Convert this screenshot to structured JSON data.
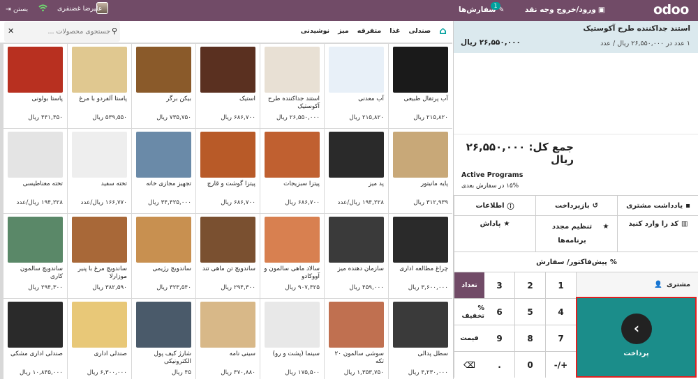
{
  "topbar": {
    "logo": "odoo",
    "cash_in_out": "ورود/خروج وجه نقد",
    "orders_label": "سفارش‌ها",
    "orders_badge": "1",
    "user_name": "علیرضا غضنفری",
    "close_label": "بستن"
  },
  "search": {
    "placeholder": "جستجوی محصولات ..."
  },
  "categories": [
    "صندلی",
    "غذا",
    "متفرقه",
    "میز",
    "نوشیدنی"
  ],
  "products": [
    {
      "name": "آب پرتقال طبیعی",
      "price": "۲۱۵,۸۲۰ ریال",
      "color": "#1a1a1a"
    },
    {
      "name": "آب معدنی",
      "price": "۲۱۵,۸۲۰ ریال",
      "color": "#e8f0f8"
    },
    {
      "name": "استند جداکننده طرح آکوستیک",
      "price": "۲۶,۵۵۰,۰۰۰ ریال",
      "color": "#e8e0d4"
    },
    {
      "name": "استیک",
      "price": "۶۸۶,۷۰۰ ریال",
      "color": "#5a3020"
    },
    {
      "name": "بیکن برگر",
      "price": "۷۳۵,۷۵۰ ریال",
      "color": "#8a5a2a"
    },
    {
      "name": "پاستا آلفردو با مرغ",
      "price": "۵۳۹,۵۵۰ ریال",
      "color": "#e0c890"
    },
    {
      "name": "پاستا بولونی",
      "price": "۴۴۱,۴۵۰ ریال",
      "color": "#b83020"
    },
    {
      "name": "پایه مانیتور",
      "price": "۳۱۲,۹۳۹ ریال",
      "color": "#c8a878"
    },
    {
      "name": "پد میز",
      "price": "۱۹۴,۲۲۸ ریال/عدد",
      "color": "#2a2a2a"
    },
    {
      "name": "پیتزا سبزیجات",
      "price": "۶۸۶,۷۰۰ ریال",
      "color": "#c06030"
    },
    {
      "name": "پیتزا گوشت و قارچ",
      "price": "۶۸۶,۷۰۰ ریال",
      "color": "#b85a28"
    },
    {
      "name": "تجهیز مجازی خانه",
      "price": "۳۴,۴۲۵,۰۰۰ ریال",
      "color": "#6a8aa8"
    },
    {
      "name": "تخته سفید",
      "price": "۱۶۶,۷۷۰ ریال/عدد",
      "color": "#eeeeee"
    },
    {
      "name": "تخته مغناطیسی",
      "price": "۱۹۴,۲۲۸ ریال/عدد",
      "color": "#e4e4e4"
    },
    {
      "name": "چراغ مطالعه اداری",
      "price": "۳,۶۰۰,۰۰۰ ریال",
      "color": "#2a2a2a"
    },
    {
      "name": "سازمان دهنده میز",
      "price": "۴۵۹,۰۰۰ ریال",
      "color": "#3a3a3a"
    },
    {
      "name": "سالاد ماهی سالمون و آووکادو",
      "price": "۹۰۷,۴۲۵ ریال",
      "color": "#d88050"
    },
    {
      "name": "ساندویچ تن ماهی تند",
      "price": "۲۹۴,۳۰۰ ریال",
      "color": "#7a5030"
    },
    {
      "name": "ساندویچ رژیمی",
      "price": "۳۲۳,۵۴۰ ریال",
      "color": "#c89050"
    },
    {
      "name": "ساندویچ مرغ با پنیر موزارلا",
      "price": "۳۸۲,۵۹۰ ریال",
      "color": "#a86838"
    },
    {
      "name": "ساندویچ سالمون کاری",
      "price": "۲۹۴,۳۰۰ ریال",
      "color": "#5a8868"
    },
    {
      "name": "سطل پدالی",
      "price": "۴,۲۳۰,۰۰۰ ریال",
      "color": "#3a3a3a"
    },
    {
      "name": "سوشی سالمون ۲۰ تکه",
      "price": "۱,۳۵۳,۷۵۰ ریال",
      "color": "#c07050"
    },
    {
      "name": "سینما (پشت و رو)",
      "price": "۱۷۵,۵۰۰ ریال",
      "color": "#e8e8e8"
    },
    {
      "name": "سینی نامه",
      "price": "۴۷۰,۸۸۰ ریال",
      "color": "#d8b888"
    },
    {
      "name": "شارژ کیف پول الکترونیکی",
      "price": "۴۵ ریال",
      "color": "#4a5a6a"
    },
    {
      "name": "صندلی اداری",
      "price": "۶,۳۰۰,۰۰۰ ریال",
      "color": "#e8c878"
    },
    {
      "name": "صندلی اداری مشکی",
      "price": "۱۰,۸۴۵,۰۰۰ ریال",
      "color": "#2a2a2a"
    }
  ],
  "order": {
    "line_name": "استند جداکننده طرح آکوستیک",
    "line_qty": "۱ عدد در ۲۶,۵۵۰,۰۰۰ ریال / عدد",
    "line_price": "۲۶,۵۵۰,۰۰۰ ریال",
    "total": "جمع کل: ۲۶,۵۵۰,۰۰۰ ریال",
    "programs_title": "Active Programs",
    "programs_desc": "۱۵% در سفارش بعدی"
  },
  "actions": {
    "customer_note": "یادداشت مشتری",
    "refund": "بازپرداخت",
    "info": "اطلاعات",
    "enter_code": "کد را وارد کنید",
    "reset_programs": "تنظیم مجدد برنامه‌ها",
    "reward": "پاداش",
    "quotation": "پیش‌فاکتور/ سفارش"
  },
  "numpad": {
    "keys": [
      "1",
      "2",
      "3",
      "4",
      "5",
      "6",
      "7",
      "8",
      "9",
      "+/-",
      "0",
      "."
    ],
    "qty": "تعداد",
    "disc": "% تخفیف",
    "price": "قیمت",
    "backspace": "⌫"
  },
  "customer_label": "مشتری",
  "payment_label": "پرداخت"
}
